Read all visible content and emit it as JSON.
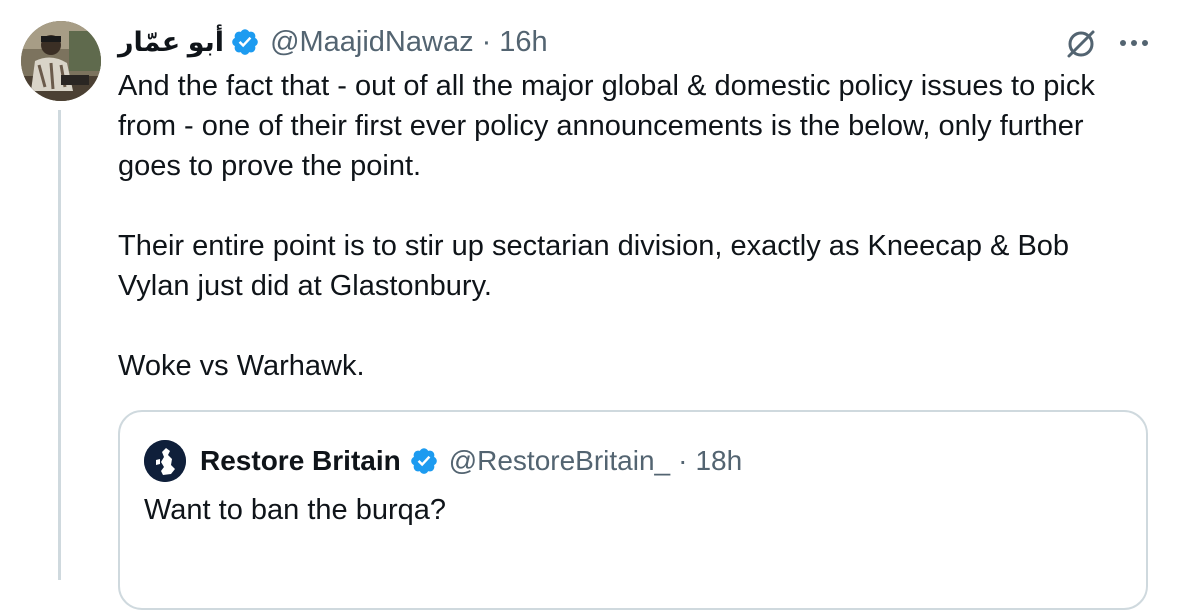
{
  "tweet": {
    "author_name": "أبو عمّار",
    "handle": "@MaajidNawaz",
    "separator": "·",
    "time": "16h",
    "text": "And the fact that - out of all the major global & domestic policy issues to pick from - one of their first ever policy announcements is the below, only further goes to prove the point.\n\nTheir entire point is to stir up sectarian division, exactly as Kneecap & Bob Vylan just did at Glastonbury.\n\nWoke vs Warhawk."
  },
  "quote": {
    "author_name": "Restore Britain",
    "handle": "@RestoreBritain_",
    "separator": "·",
    "time": "18h",
    "text": "Want to ban the burqa?"
  },
  "icons": {
    "verified": "verified-badge-icon",
    "grok": "grok-icon",
    "more": "more-options-icon"
  },
  "colors": {
    "verified_blue": "#1d9bf0",
    "secondary_text": "#536471",
    "primary_text": "#0f1419",
    "border": "#cfd9de"
  }
}
